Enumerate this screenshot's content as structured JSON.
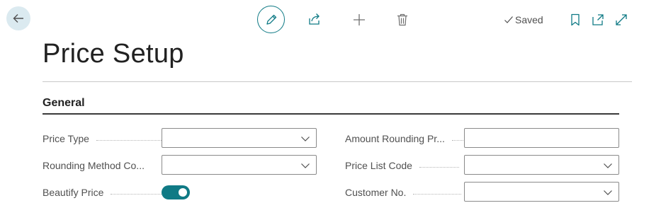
{
  "header": {
    "saved_label": "Saved"
  },
  "page": {
    "title": "Price Setup"
  },
  "section": {
    "title": "General"
  },
  "fields": {
    "price_type": {
      "label": "Price Type",
      "value": ""
    },
    "rounding_method": {
      "label": "Rounding Method Co...",
      "value": ""
    },
    "beautify_price": {
      "label": "Beautify Price",
      "value": true
    },
    "amount_rounding": {
      "label": "Amount Rounding Pr...",
      "value": ""
    },
    "price_list_code": {
      "label": "Price List Code",
      "value": ""
    },
    "customer_no": {
      "label": "Customer No.",
      "value": ""
    }
  },
  "colors": {
    "accent": "#0f7a85",
    "back_button_bg": "#dbeaf0"
  },
  "icons": [
    "back-arrow-icon",
    "pencil-icon",
    "share-icon",
    "plus-icon",
    "trash-icon",
    "checkmark-icon",
    "bookmark-icon",
    "popout-icon",
    "expand-icon",
    "chevron-down-icon"
  ]
}
